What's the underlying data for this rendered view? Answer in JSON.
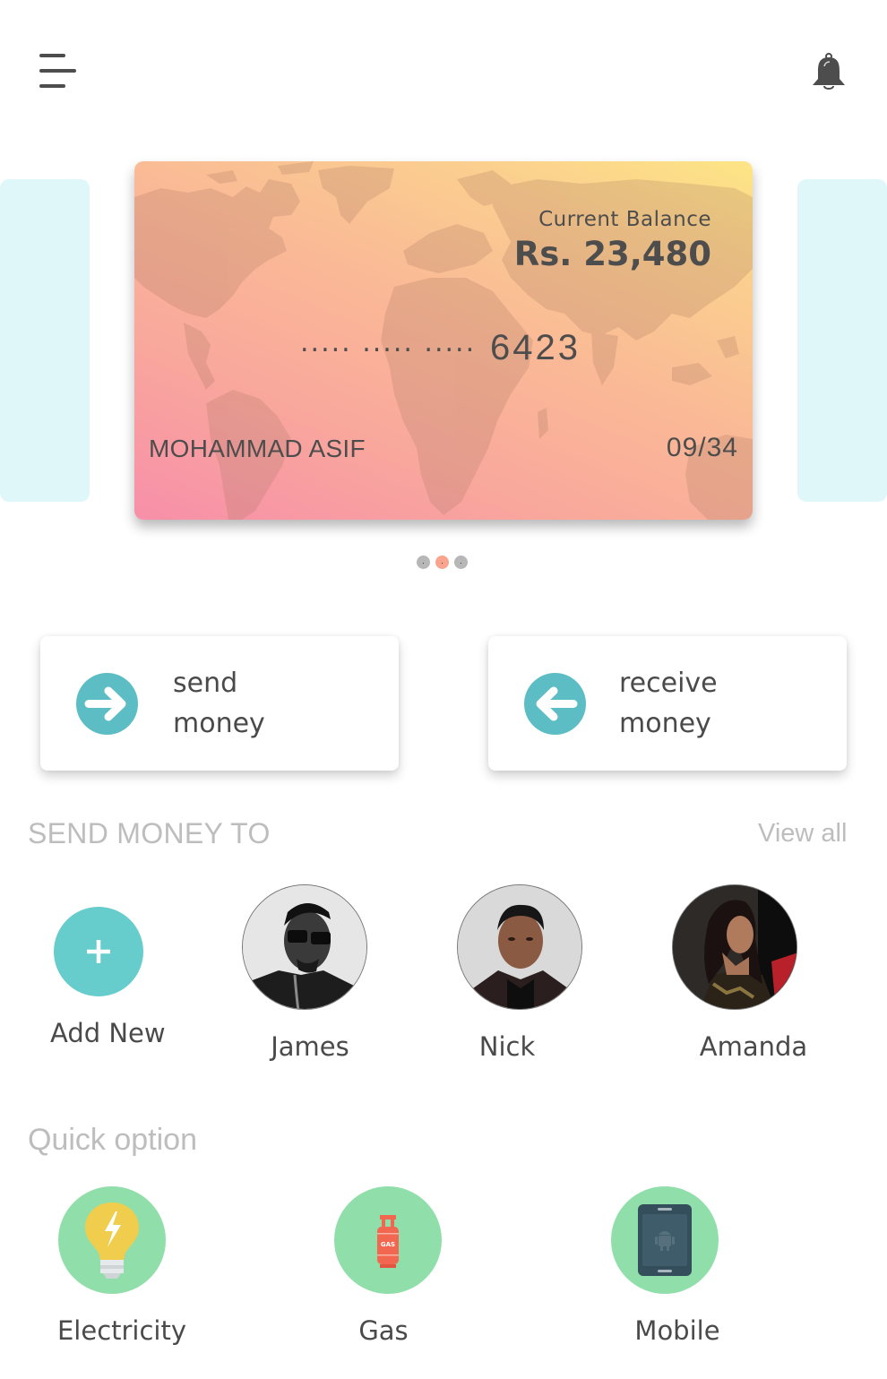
{
  "header": {
    "menu_icon": "hamburger-menu-icon",
    "notification_icon": "bell-icon"
  },
  "card": {
    "balance_label": "Current Balance",
    "balance_value": "Rs. 23,480",
    "masked_number": "..... ..... .....",
    "last_four": "6423",
    "holder_name": "MOHAMMAD ASIF",
    "expiry": "09/34",
    "background_image": "world-map",
    "gradient_colors": [
      "#f78fa9",
      "#fab996",
      "#fde585"
    ]
  },
  "carousel": {
    "page_count": 3,
    "active_index": 1,
    "active_color": "#f9a48e",
    "inactive_color": "#b7b7b7"
  },
  "actions": [
    {
      "line1": "send",
      "line2": "money",
      "icon": "arrow-right-circle-icon",
      "color": "#5cbec4"
    },
    {
      "line1": "receive",
      "line2": "money",
      "icon": "arrow-left-circle-icon",
      "color": "#5cbec4"
    }
  ],
  "send_money_to": {
    "title": "SEND MONEY TO",
    "view_all": "View all",
    "add_new": {
      "label": "Add New",
      "icon": "plus-icon",
      "color": "#66cccc"
    },
    "contacts": [
      {
        "name": "James"
      },
      {
        "name": "Nick"
      },
      {
        "name": "Amanda"
      }
    ]
  },
  "quick_option": {
    "title": "Quick option",
    "items": [
      {
        "label": "Electricity",
        "icon": "lightbulb-icon"
      },
      {
        "label": "Gas",
        "icon": "gas-cylinder-icon",
        "icon_text": "GAS"
      },
      {
        "label": "Mobile",
        "icon": "mobile-phone-icon"
      }
    ],
    "circle_color": "#90dfaa"
  }
}
